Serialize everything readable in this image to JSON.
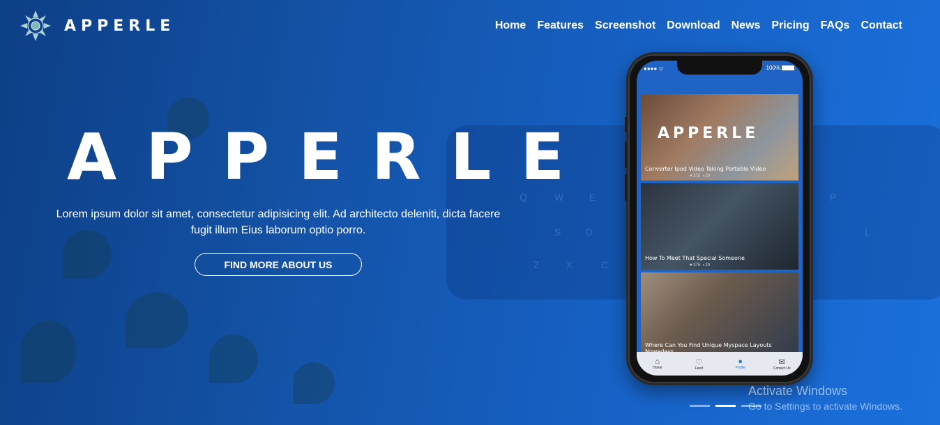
{
  "brand": {
    "logo_icon": "mandala-logo-icon",
    "logo_text": "APPERLE"
  },
  "nav": {
    "items": [
      {
        "label": "Home"
      },
      {
        "label": "Features"
      },
      {
        "label": "Screenshot"
      },
      {
        "label": "Download"
      },
      {
        "label": "News"
      },
      {
        "label": "Pricing"
      },
      {
        "label": "FAQs"
      },
      {
        "label": "Contact"
      }
    ]
  },
  "hero": {
    "title": "APPERLE",
    "text": "Lorem ipsum dolor sit amet, consectetur adipisicing elit. Ad architecto deleniti, dicta facere fugit illum Eius laborum optio porro.",
    "cta_label": "FIND MORE ABOUT US"
  },
  "phone": {
    "status_left": "●●●● ᯤ",
    "battery_label": "100%",
    "cards": [
      {
        "caption": "Converter Ipod Video Taking Portable Video",
        "likes": "375",
        "comments": "20",
        "overlay_title": "APPERLE"
      },
      {
        "caption": "How To Meet That Special Someone",
        "likes": "375",
        "comments": "20"
      },
      {
        "caption": "Where Can You Find Unique Myspace Layouts Nowadays"
      }
    ],
    "tabs": [
      {
        "label": "Home",
        "icon": "home-icon",
        "glyph": "⌂"
      },
      {
        "label": "Feed",
        "icon": "heart-icon",
        "glyph": "♡"
      },
      {
        "label": "Profile",
        "icon": "user-icon",
        "glyph": "●"
      },
      {
        "label": "Contact Us",
        "icon": "envelope-icon",
        "glyph": "✉"
      }
    ]
  },
  "slider": {
    "active_index": 1
  },
  "watermark": {
    "line1": "Activate Windows",
    "line2": "Go to Settings to activate Windows."
  },
  "colors": {
    "background_start": "#0d3f86",
    "background_end": "#1b70dc",
    "accent": "#2c77d8"
  }
}
